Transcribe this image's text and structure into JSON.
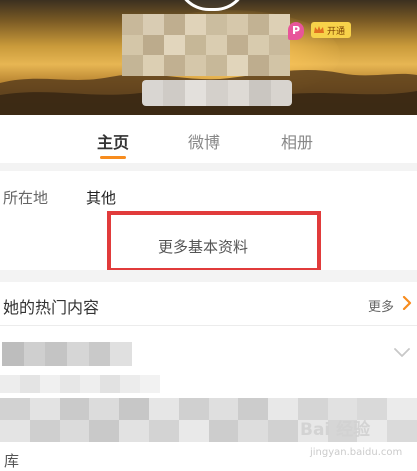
{
  "profile": {
    "vip_label": "开通"
  },
  "tabs": [
    {
      "label": "主页",
      "active": true
    },
    {
      "label": "微博",
      "active": false
    },
    {
      "label": "相册",
      "active": false
    }
  ],
  "info": {
    "location_label": "所在地",
    "location_value": "其他",
    "more_info_label": "更多基本资料"
  },
  "hot": {
    "title": "她的热门内容",
    "more_label": "更多"
  },
  "watermark": {
    "brand": "Bai 经验",
    "url": "jingyan.baidu.com"
  },
  "bottom": {
    "partial_text": "库"
  },
  "colors": {
    "accent": "#f78c1e",
    "highlight_box": "#e13b3b",
    "vip_badge": "#f7d24a",
    "p_badge": "#e8559a"
  }
}
